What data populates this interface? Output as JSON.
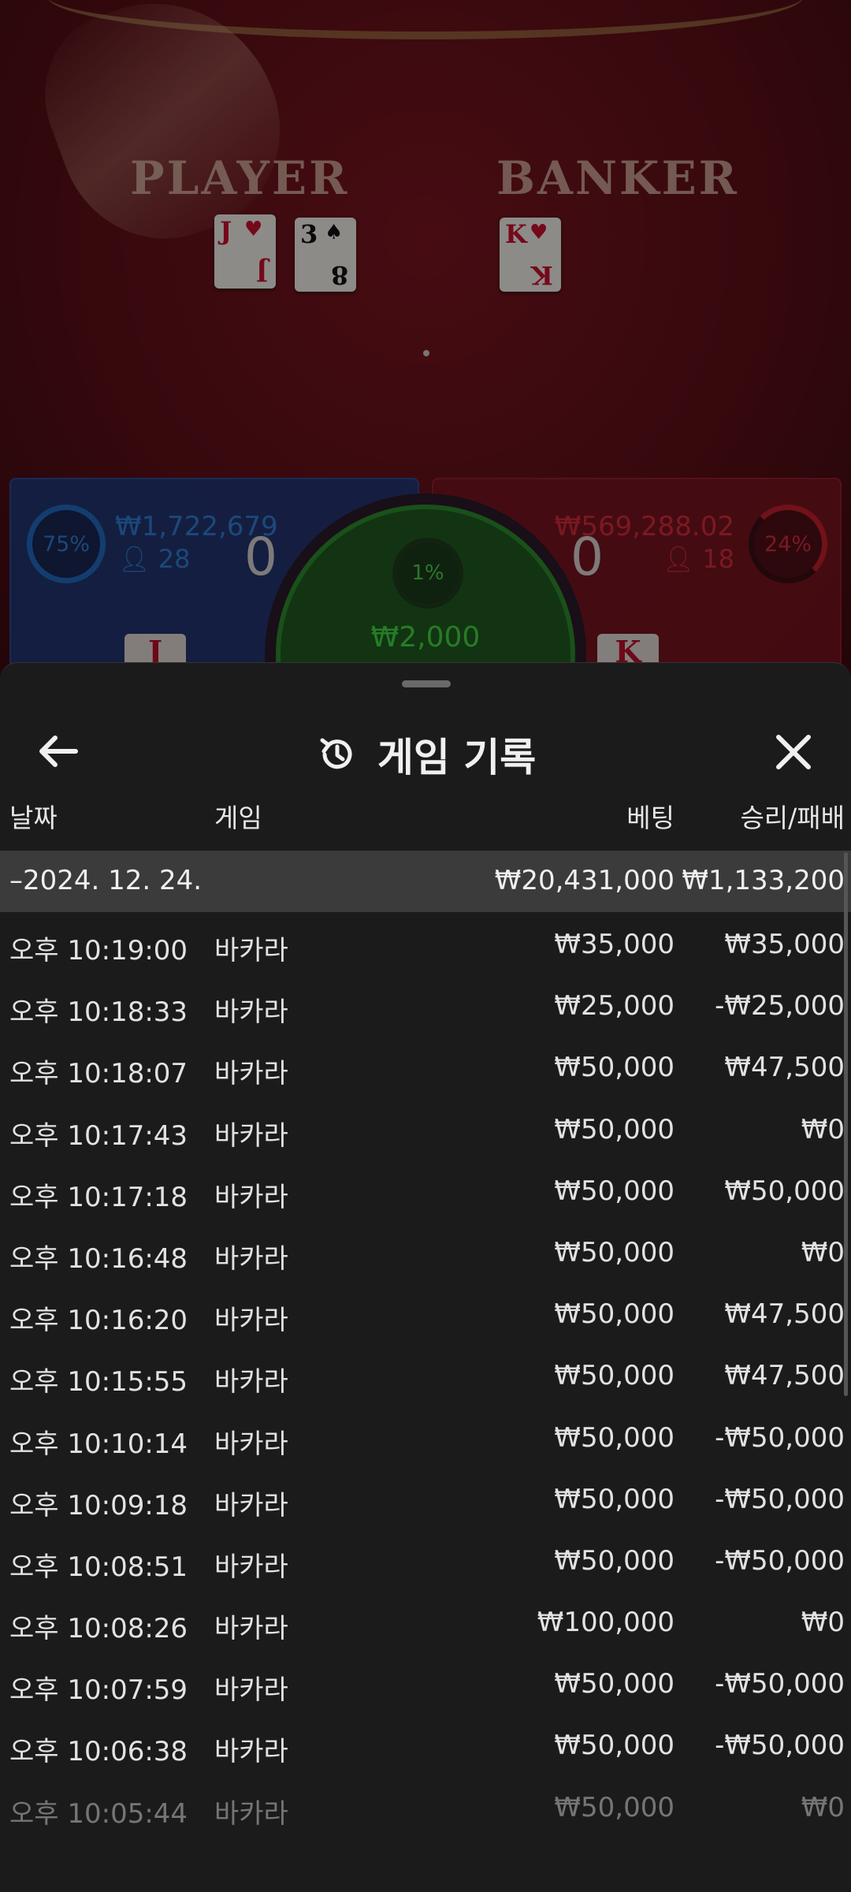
{
  "game": {
    "player_label": "PLAYER",
    "banker_label": "BANKER",
    "player_cards": [
      {
        "rank": "J",
        "suit": "♥",
        "color": "red"
      },
      {
        "rank": "3",
        "suit": "♠",
        "color": "blk"
      }
    ],
    "banker_cards": [
      {
        "rank": "K",
        "suit": "♥",
        "color": "red"
      }
    ],
    "player": {
      "percent": "75%",
      "amount": "₩1,722,679",
      "count": "28",
      "score": "0",
      "card": "J"
    },
    "banker": {
      "percent": "24%",
      "amount": "₩569,288.02",
      "count": "18",
      "score": "0",
      "card": "K"
    },
    "tie": {
      "percent": "1%",
      "amount": "₩2,000"
    },
    "colors": {
      "player": "#1e74d2",
      "banker": "#d0202e",
      "tie": "#44d444"
    }
  },
  "sheet": {
    "title": "게임 기록",
    "back_icon": "arrow-left-icon",
    "title_icon": "history-icon",
    "close_icon": "close-icon",
    "columns": {
      "date": "날짜",
      "game": "게임",
      "bet": "베팅",
      "result": "승리/패배"
    },
    "day": {
      "date": "–2024. 12. 24.",
      "bet_total": "₩20,431,000",
      "result_total": "₩1,133,200"
    },
    "rows": [
      {
        "time": "오후 10:19:00",
        "game": "바카라",
        "bet": "₩35,000",
        "result": "₩35,000"
      },
      {
        "time": "오후 10:18:33",
        "game": "바카라",
        "bet": "₩25,000",
        "result": "-₩25,000"
      },
      {
        "time": "오후 10:18:07",
        "game": "바카라",
        "bet": "₩50,000",
        "result": "₩47,500"
      },
      {
        "time": "오후 10:17:43",
        "game": "바카라",
        "bet": "₩50,000",
        "result": "₩0"
      },
      {
        "time": "오후 10:17:18",
        "game": "바카라",
        "bet": "₩50,000",
        "result": "₩50,000"
      },
      {
        "time": "오후 10:16:48",
        "game": "바카라",
        "bet": "₩50,000",
        "result": "₩0"
      },
      {
        "time": "오후 10:16:20",
        "game": "바카라",
        "bet": "₩50,000",
        "result": "₩47,500"
      },
      {
        "time": "오후 10:15:55",
        "game": "바카라",
        "bet": "₩50,000",
        "result": "₩47,500"
      },
      {
        "time": "오후 10:10:14",
        "game": "바카라",
        "bet": "₩50,000",
        "result": "-₩50,000"
      },
      {
        "time": "오후 10:09:18",
        "game": "바카라",
        "bet": "₩50,000",
        "result": "-₩50,000"
      },
      {
        "time": "오후 10:08:51",
        "game": "바카라",
        "bet": "₩50,000",
        "result": "-₩50,000"
      },
      {
        "time": "오후 10:08:26",
        "game": "바카라",
        "bet": "₩100,000",
        "result": "₩0"
      },
      {
        "time": "오후 10:07:59",
        "game": "바카라",
        "bet": "₩50,000",
        "result": "-₩50,000"
      },
      {
        "time": "오후 10:06:38",
        "game": "바카라",
        "bet": "₩50,000",
        "result": "-₩50,000"
      },
      {
        "time": "오후 10:05:44",
        "game": "바카라",
        "bet": "₩50,000",
        "result": "₩0"
      }
    ]
  }
}
